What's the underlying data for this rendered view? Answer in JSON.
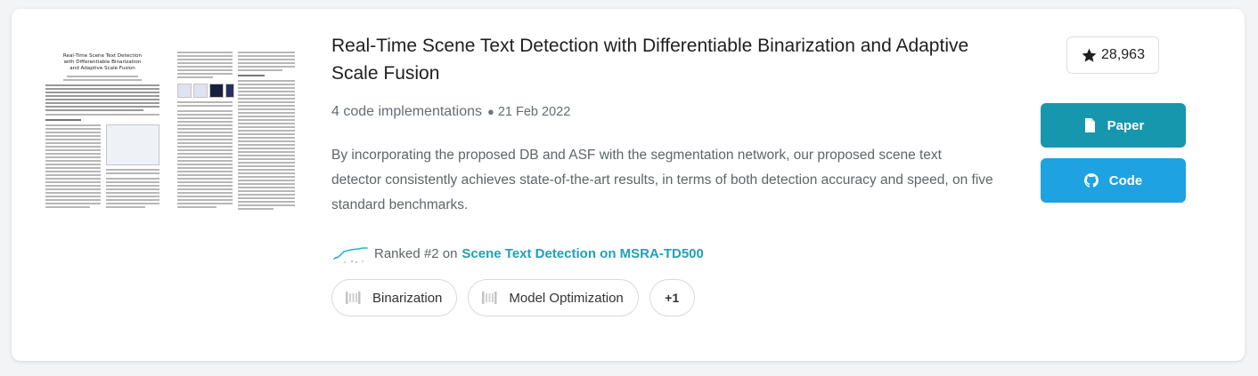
{
  "paper": {
    "thumbnail_title": "Real-Time Scene Text Detection with Differentiable Binarization and Adaptive Scale Fusion",
    "title": "Real-Time Scene Text Detection with Differentiable Binarization and Adaptive Scale Fusion",
    "implementations": "4 code implementations",
    "date": "21 Feb 2022",
    "abstract": "By incorporating the proposed DB and ASF with the segmentation network, our proposed scene text detector consistently achieves state-of-the-art results, in terms of both detection accuracy and speed, on five standard benchmarks."
  },
  "ranking": {
    "text": "Ranked #2 on",
    "task_link": "Scene Text Detection on MSRA-TD500",
    "sparkline_icon": "sparkline-chart"
  },
  "tags": [
    {
      "label": "Binarization",
      "icon": "task-icon"
    },
    {
      "label": "Model Optimization",
      "icon": "task-icon"
    }
  ],
  "more_tags": "+1",
  "stars": {
    "count": "28,963",
    "icon": "star-icon"
  },
  "buttons": {
    "paper": {
      "label": "Paper",
      "icon": "file-icon",
      "color": "#1697ad"
    },
    "code": {
      "label": "Code",
      "icon": "github-icon",
      "color": "#1fa2e1"
    }
  },
  "colors": {
    "link": "#21a0b7",
    "sparkline": "#21b5c9"
  }
}
